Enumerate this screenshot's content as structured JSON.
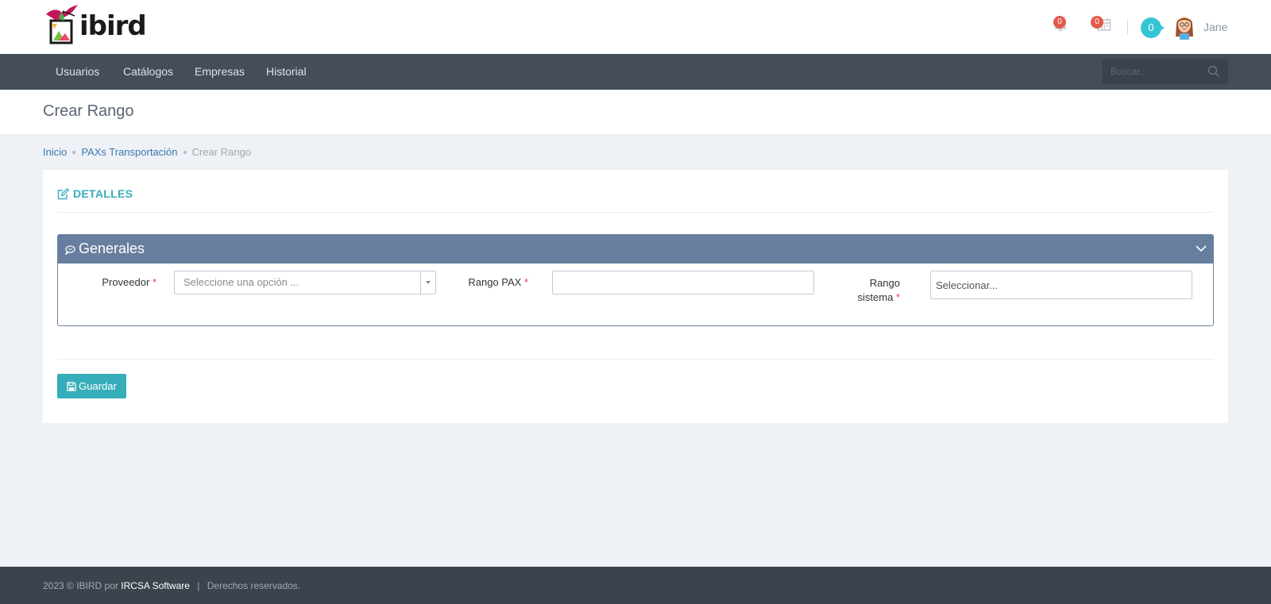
{
  "brand": {
    "name": "ibird"
  },
  "header": {
    "notifications_count": "0",
    "calendar_count": "0",
    "counter": "0",
    "user_name": "Jane"
  },
  "nav": {
    "items": [
      {
        "label": "Usuarios"
      },
      {
        "label": "Catálogos"
      },
      {
        "label": "Empresas"
      },
      {
        "label": "Historial"
      }
    ],
    "search_placeholder": "Buscar..."
  },
  "page": {
    "title": "Crear Rango"
  },
  "breadcrumb": {
    "items": [
      {
        "label": "Inicio"
      },
      {
        "label": "PAXs Transportación"
      }
    ],
    "current": "Crear Rango"
  },
  "portlet": {
    "title": "DETALLES",
    "panel": {
      "title": "Generales",
      "fields": {
        "proveedor": {
          "label": "Proveedor",
          "required_mark": "*",
          "placeholder": "Seleccione una opción ..."
        },
        "rango_pax": {
          "label": "Rango PAX",
          "required_mark": "*",
          "value": ""
        },
        "rango_sistema": {
          "label_line1": "Rango",
          "label_line2": "sistema",
          "required_mark": "*",
          "placeholder": "Seleccionar..."
        }
      }
    },
    "save_label": "Guardar"
  },
  "footer": {
    "prefix": "2023 © IBIRD por",
    "link": "IRCSA Software",
    "separator": "|",
    "suffix": "Derechos reservados."
  },
  "colors": {
    "nav_bg": "#444d58",
    "accent": "#36aeb9",
    "panel_head": "#687e9f",
    "badge_red": "#e35a4b",
    "counter_bg": "#36c6d3"
  },
  "icons": [
    "bird-logo-icon",
    "bell-icon",
    "calendar-icon",
    "search-icon",
    "edit-icon",
    "comment-icon",
    "chevron-down-icon",
    "save-icon",
    "user-avatar"
  ]
}
